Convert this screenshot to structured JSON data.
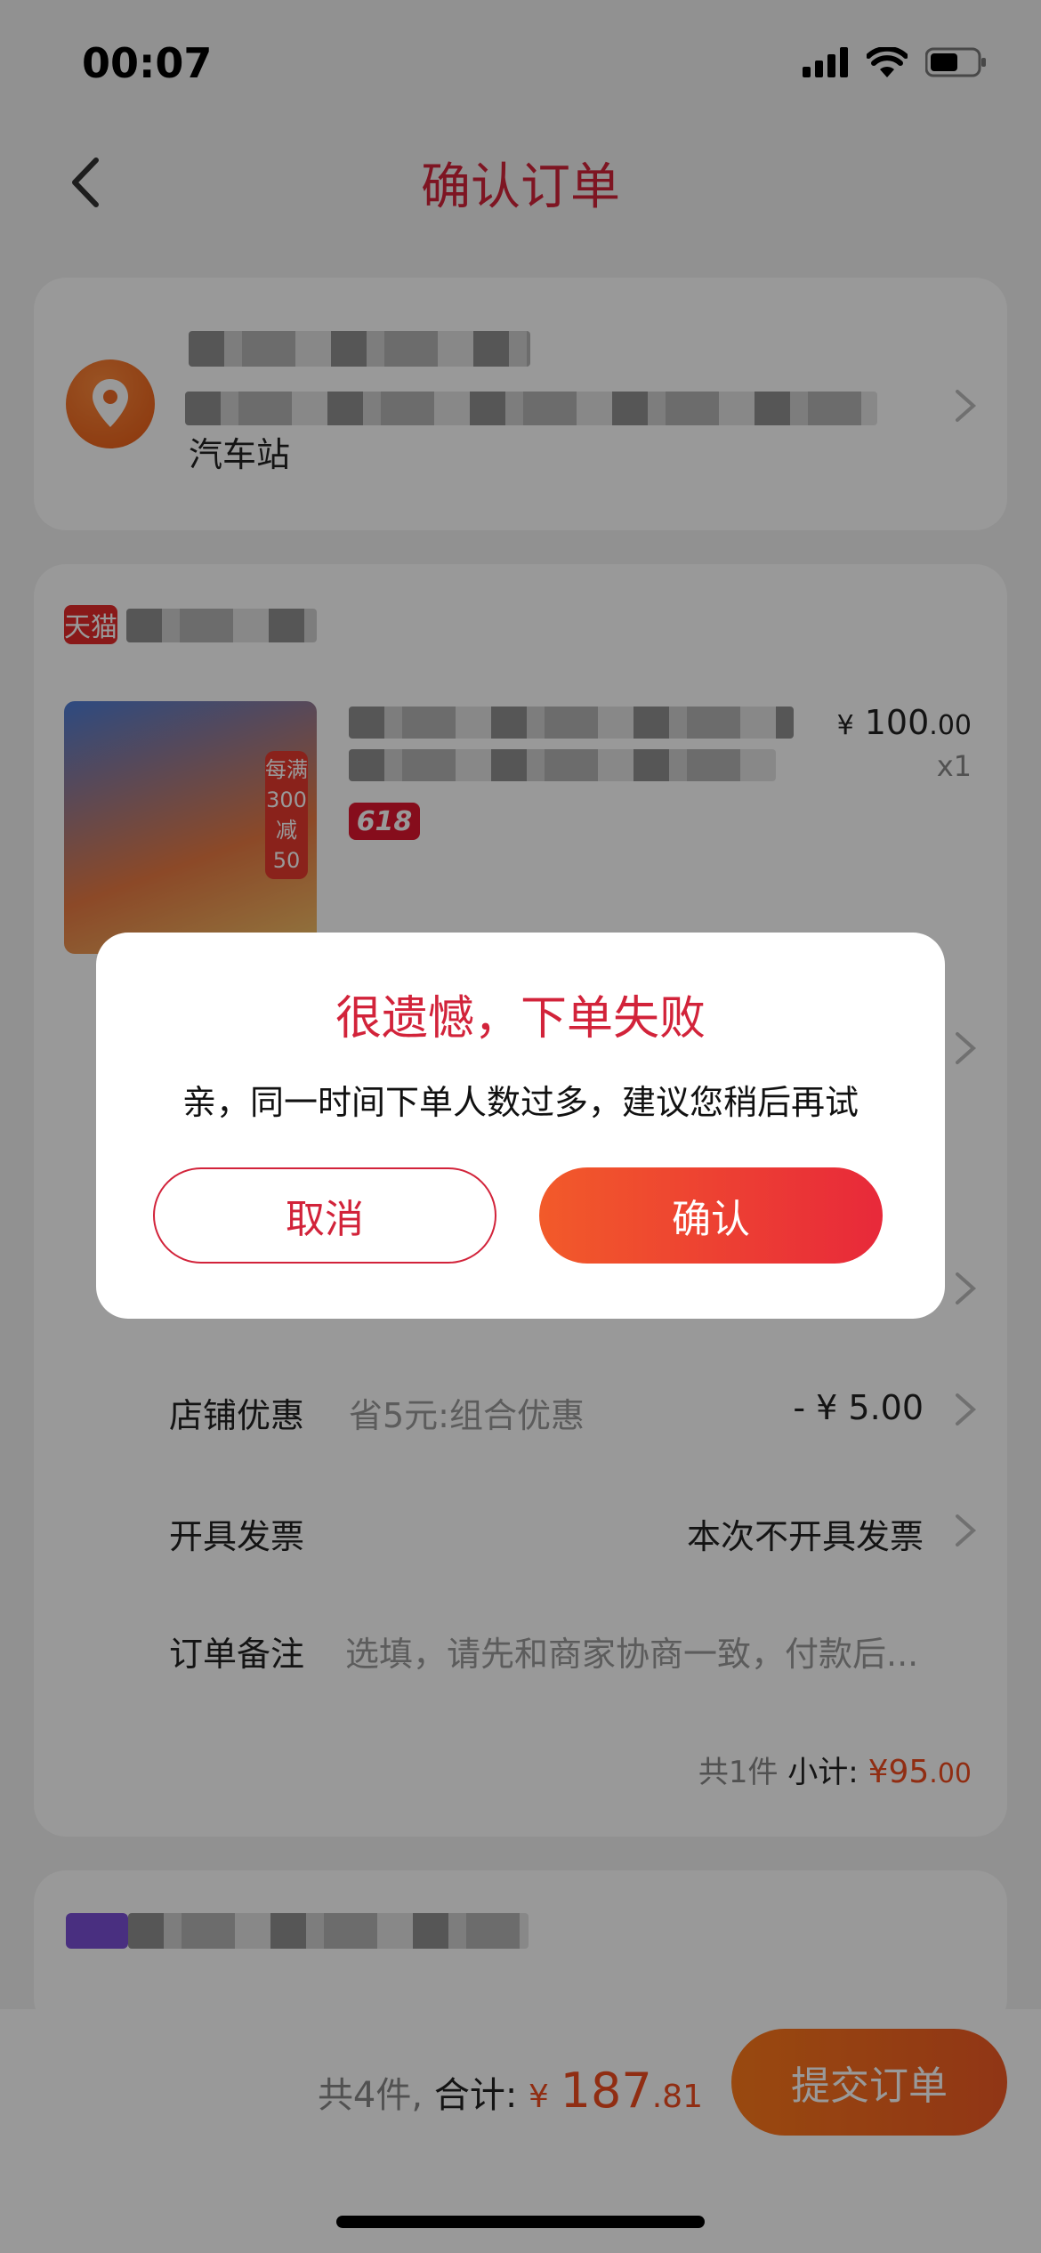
{
  "status_bar": {
    "time": "00:07"
  },
  "header": {
    "title": "确认订单"
  },
  "address": {
    "tail_text": "汽车站"
  },
  "store": {
    "platform_badge": "天猫"
  },
  "product": {
    "price_symbol": "¥",
    "price_int": "100",
    "price_dec": ".00",
    "quantity": "x1",
    "tag": "618",
    "image_badge": "每满300减50"
  },
  "rows": {
    "shop_discount": {
      "label": "店铺优惠",
      "sub": "省5元:组合优惠",
      "value": "- ¥ 5.00"
    },
    "invoice": {
      "label": "开具发票",
      "value": "本次不开具发票"
    },
    "remark": {
      "label": "订单备注",
      "placeholder": "选填，请先和商家协商一致，付款后..."
    }
  },
  "subtotal": {
    "count": "共1件",
    "label": "小计:",
    "yen": "¥",
    "int": "95",
    "dec": ".00"
  },
  "bottom": {
    "count": "共4件,",
    "label": "合计:",
    "yen": "¥",
    "int": "187",
    "dec": ".81",
    "submit_label": "提交订单"
  },
  "dialog": {
    "title": "很遗憾，下单失败",
    "message": "亲，同一时间下单人数过多，建议您稍后再试",
    "cancel_label": "取消",
    "confirm_label": "确认"
  },
  "colors": {
    "accent": "#d2233a",
    "price": "#f04b1e",
    "submit": "#f15a24"
  }
}
